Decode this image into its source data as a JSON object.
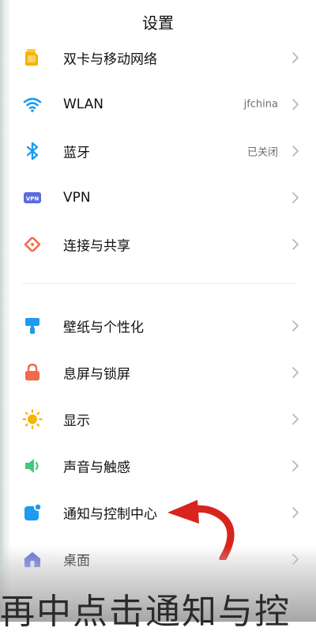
{
  "header": {
    "title": "设置"
  },
  "groups": [
    {
      "items": [
        {
          "id": "sim-network",
          "label": "双卡与移动网络",
          "value": "",
          "icon": "sim-card-icon",
          "color": "#F5B400"
        },
        {
          "id": "wlan",
          "label": "WLAN",
          "value": "jfchina",
          "icon": "wifi-icon",
          "color": "#1E9BF0"
        },
        {
          "id": "bluetooth",
          "label": "蓝牙",
          "value": "已关闭",
          "icon": "bluetooth-icon",
          "color": "#1E9BF0"
        },
        {
          "id": "vpn",
          "label": "VPN",
          "value": "",
          "icon": "vpn-icon",
          "color": "#5B6BDB"
        },
        {
          "id": "connection-share",
          "label": "连接与共享",
          "value": "",
          "icon": "share-icon",
          "color": "#F06A4E"
        }
      ]
    },
    {
      "items": [
        {
          "id": "wallpaper",
          "label": "壁纸与个性化",
          "value": "",
          "icon": "brush-icon",
          "color": "#1E9BF0"
        },
        {
          "id": "lockscreen",
          "label": "息屏与锁屏",
          "value": "",
          "icon": "lock-icon",
          "color": "#F06A4E"
        },
        {
          "id": "display",
          "label": "显示",
          "value": "",
          "icon": "sun-icon",
          "color": "#F5B400"
        },
        {
          "id": "sound",
          "label": "声音与触感",
          "value": "",
          "icon": "speaker-icon",
          "color": "#3ECB7A"
        },
        {
          "id": "notification",
          "label": "通知与控制中心",
          "value": "",
          "icon": "notification-icon",
          "color": "#1E9BF0"
        },
        {
          "id": "desktop",
          "label": "桌面",
          "value": "",
          "icon": "home-icon",
          "color": "#5B6BDB"
        }
      ]
    }
  ],
  "overlay": {
    "caption": "再中点击通知与控",
    "arrow_color": "#D8241C"
  }
}
